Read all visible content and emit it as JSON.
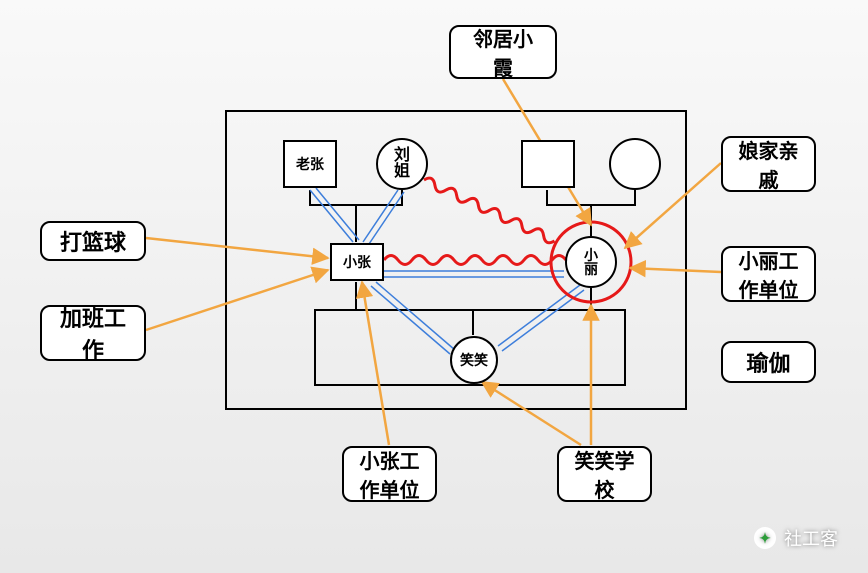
{
  "external": {
    "neighbor": "邻居小\n霞",
    "basketball": "打篮球",
    "overtime": "加班工\n作",
    "zhang_work": "小张工\n作单位",
    "xiaoxiao_school": "笑笑学\n校",
    "yoga": "瑜伽",
    "li_work": "小丽工\n作单位",
    "relatives": "娘家亲\n戚"
  },
  "family": {
    "lao_zhang": "老张",
    "liu_jie": "刘\n姐",
    "xiao_zhang": "小张",
    "xiao_li": "小\n丽",
    "xiaoxiao": "笑笑"
  },
  "watermark": {
    "text": "社工客"
  }
}
